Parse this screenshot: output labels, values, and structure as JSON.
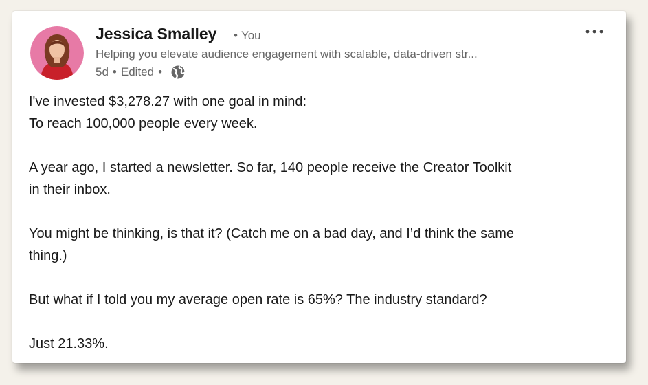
{
  "post": {
    "author_name": "Jessica Smalley",
    "degree": "You",
    "headline": "Helping you elevate audience engagement with scalable, data-driven str...",
    "time_ago": "5d",
    "edited": "Edited",
    "visibility_icon": "globe-icon",
    "more_icon": "more-horizontal-icon",
    "body": {
      "line1": "I've invested $3,278.27 with one goal in mind:",
      "line2": "To reach 100,000 people every week.",
      "line3": "A year ago, I started a newsletter. So far, 140 people receive the Creator Toolkit",
      "line4": "in their inbox.",
      "line5": "You might be thinking, is that it? (Catch me on a bad day, and I’d think the same",
      "line6": "thing.)",
      "line7": "But what if I told you my average open rate is 65%? The industry standard?",
      "line8": "Just 21.33%."
    }
  }
}
